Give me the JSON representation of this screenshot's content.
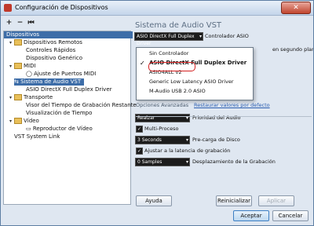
{
  "window": {
    "title": "Configuración de Dispositivos",
    "close_label": "✕"
  },
  "toolbar": {
    "add": "+",
    "remove": "−",
    "reset": "⏮"
  },
  "tree": {
    "header": "Dispositivos",
    "items": [
      {
        "label": "Dispositivos Remotos",
        "level": 1,
        "icon": "folder-icon"
      },
      {
        "label": "Controles Rápidos",
        "level": 2
      },
      {
        "label": "Dispositivo Genérico",
        "level": 2
      },
      {
        "label": "MIDI",
        "level": 1,
        "icon": "folder-icon"
      },
      {
        "label": "Ajuste de Puertos MIDI",
        "level": 2,
        "icon": "midi-port-icon"
      },
      {
        "label": "Sistema de Audio VST",
        "level": 1,
        "icon": "audio-icon",
        "selected": true
      },
      {
        "label": "ASIO DirectX Full Duplex Driver",
        "level": 2
      },
      {
        "label": "Transporte",
        "level": 1,
        "icon": "folder-icon"
      },
      {
        "label": "Visor del Tiempo de Grabación Restante",
        "level": 2
      },
      {
        "label": "Visualización de Tiempo",
        "level": 2
      },
      {
        "label": "Vídeo",
        "level": 1,
        "icon": "folder-icon"
      },
      {
        "label": "Reproductor de Vídeo",
        "level": 2,
        "icon": "video-icon"
      },
      {
        "label": "VST System Link",
        "level": 1
      }
    ]
  },
  "panel": {
    "title": "Sistema de Audio VST",
    "driver_combo": "ASIO DirectX Full Duplex Driver",
    "driver_label": "Controlador ASIO",
    "side_text": "en segundo plano",
    "advanced_label": "Opciones Avanzadas",
    "restore_link": "Restaurar valores por defecto",
    "priority_value": "Realzar",
    "priority_label": "Prioridad del Audio",
    "multiprocess_label": "Multi-Proceso",
    "multiprocess_checked": "✓",
    "preload_value": "3 Seconds",
    "preload_label": "Pre-carga de Disco",
    "latency_checked": "✓",
    "latency_label": "Ajustar a la latencia de grabación",
    "offset_value": "0 Samples",
    "offset_label": "Desplazamiento de la Grabación"
  },
  "dropdown": {
    "items": [
      {
        "label": "Sin Controlador",
        "bold": false,
        "checked": false
      },
      {
        "label": "ASIO DirectX Full Duplex Driver",
        "bold": true,
        "checked": true
      },
      {
        "label": "ASIO4ALL v2",
        "bold": false,
        "checked": false
      },
      {
        "label": "Generic Low Latency ASIO Driver",
        "bold": false,
        "checked": false
      },
      {
        "label": "M-Audio USB 2.0 ASIO",
        "bold": false,
        "checked": false
      }
    ],
    "check_glyph": "✓"
  },
  "buttons": {
    "help": "Ayuda",
    "reset": "Reinicializar",
    "apply": "Aplicar",
    "accept": "Aceptar",
    "cancel": "Cancelar"
  },
  "colors": {
    "accent": "#3d6da8",
    "highlight": "#d42020"
  }
}
